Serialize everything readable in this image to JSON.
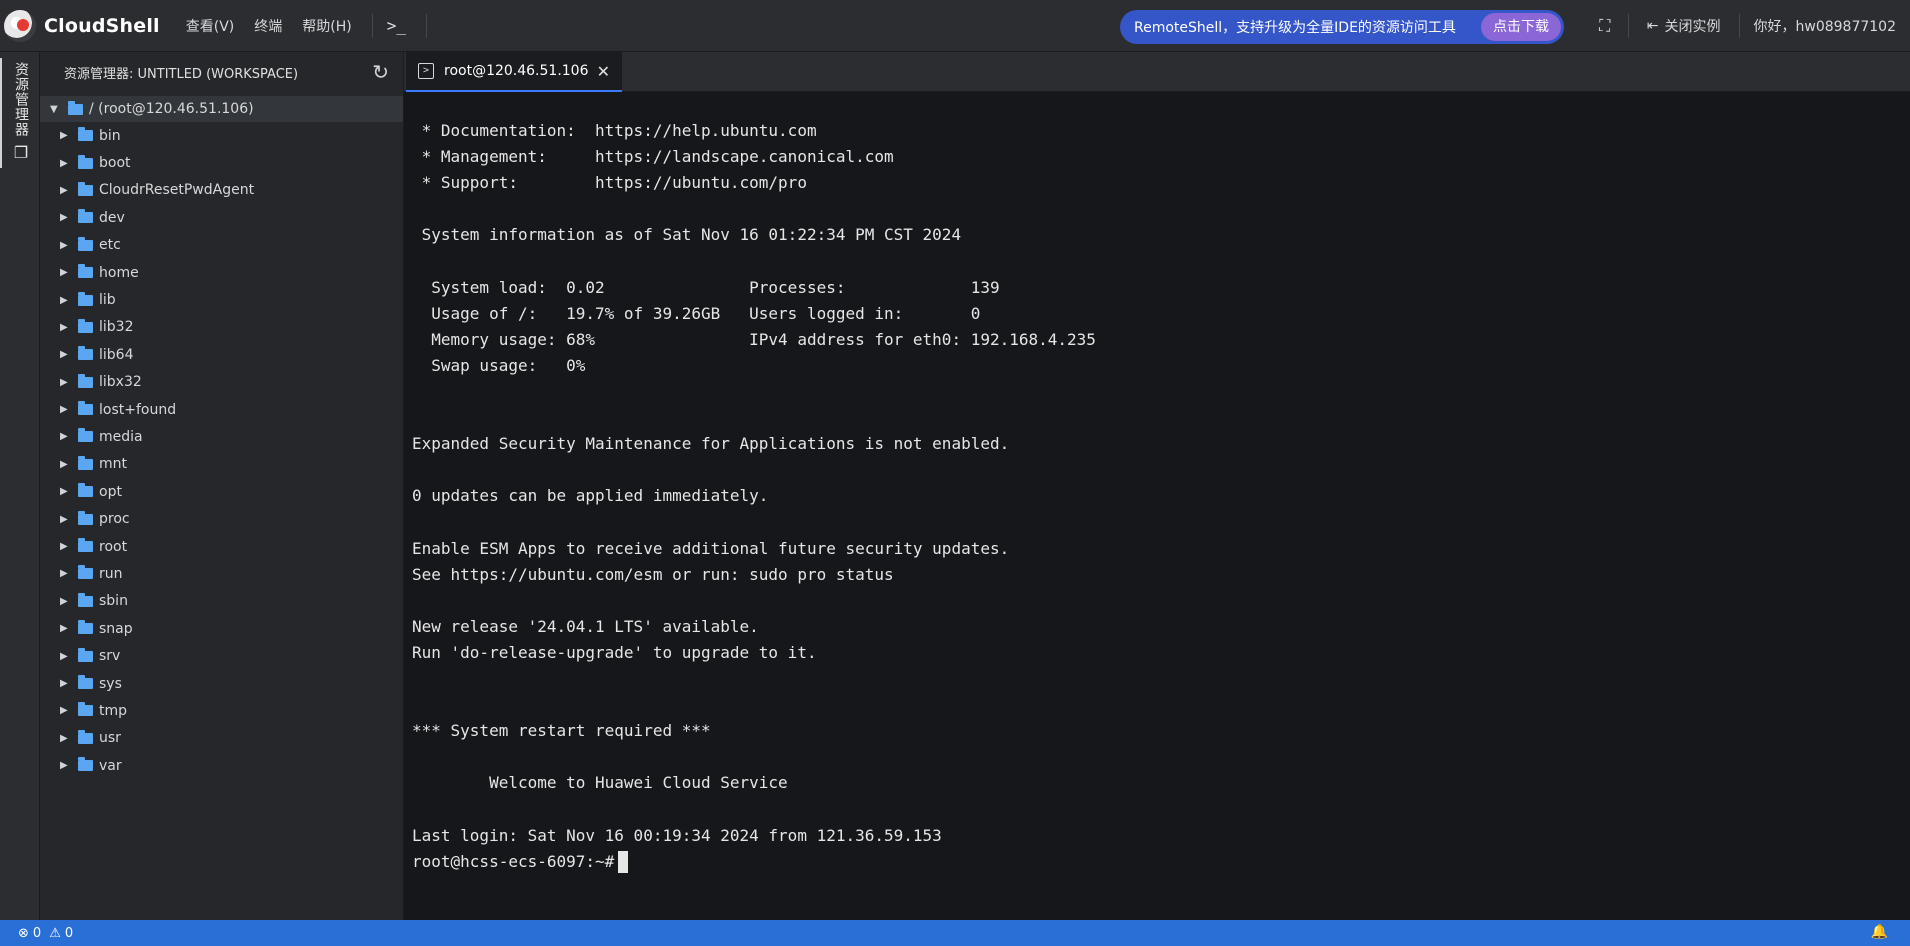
{
  "app": {
    "title": "CloudShell",
    "menu": [
      "查看(V)",
      "终端",
      "帮助(H)"
    ],
    "terminal_button_glyph": ">_"
  },
  "promo": {
    "text": "RemoteShell，支持升级为全量IDE的资源访问工具",
    "button": "点击下载"
  },
  "header_right": {
    "fullscreen_icon": "fullscreen-icon",
    "close_instance_label": "关闭实例",
    "greeting": "你好，hw089877102"
  },
  "activity_bar": {
    "explorer_label": "资源管理器",
    "explorer_icon": "files-icon"
  },
  "explorer": {
    "title": "资源管理器: UNTITLED (WORKSPACE)",
    "root": "/ (root@120.46.51.106)",
    "folders": [
      "bin",
      "boot",
      "CloudrResetPwdAgent",
      "dev",
      "etc",
      "home",
      "lib",
      "lib32",
      "lib64",
      "libx32",
      "lost+found",
      "media",
      "mnt",
      "opt",
      "proc",
      "root",
      "run",
      "sbin",
      "snap",
      "srv",
      "sys",
      "tmp",
      "usr",
      "var"
    ]
  },
  "tabs": [
    {
      "label": "root@120.46.51.106",
      "icon": "terminal-icon",
      "active": true
    }
  ],
  "terminal": {
    "lines": [
      " * Documentation:  https://help.ubuntu.com",
      " * Management:     https://landscape.canonical.com",
      " * Support:        https://ubuntu.com/pro",
      "",
      " System information as of Sat Nov 16 01:22:34 PM CST 2024",
      "",
      "  System load:  0.02               Processes:             139",
      "  Usage of /:   19.7% of 39.26GB   Users logged in:       0",
      "  Memory usage: 68%                IPv4 address for eth0: 192.168.4.235",
      "  Swap usage:   0%",
      "",
      "",
      "Expanded Security Maintenance for Applications is not enabled.",
      "",
      "0 updates can be applied immediately.",
      "",
      "Enable ESM Apps to receive additional future security updates.",
      "See https://ubuntu.com/esm or run: sudo pro status",
      "",
      "New release '24.04.1 LTS' available.",
      "Run 'do-release-upgrade' to upgrade to it.",
      "",
      "",
      "*** System restart required ***",
      "",
      "        Welcome to Huawei Cloud Service",
      "",
      "Last login: Sat Nov 16 00:19:34 2024 from 121.36.59.153"
    ],
    "prompt": "root@hcss-ecs-6097:~#"
  },
  "status_bar": {
    "errors": "0",
    "warnings": "0"
  },
  "colors": {
    "accent": "#3b79ff",
    "status_bar": "#2a6fd6",
    "promo_bg": "#3556c9",
    "promo_button": "#8b66d6",
    "folder": "#5aa6f0"
  }
}
